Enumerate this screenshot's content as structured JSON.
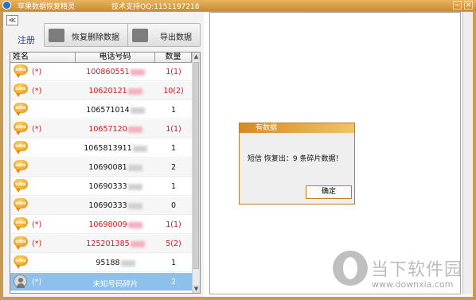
{
  "window": {
    "title": "苹果数据恢复精灵",
    "support": "技术支持QQ:1151197218",
    "min": "−",
    "close": "✕"
  },
  "toolbar": {
    "collapse": "≪",
    "register": "注册",
    "recover_label": "恢复删除数据",
    "export_label": "导出数据"
  },
  "table": {
    "headers": [
      "姓名",
      "电话号码",
      "数量"
    ],
    "rows": [
      {
        "icon": "sms-bubble-icon",
        "flag": "(*)",
        "phone": "100860551",
        "count": "1(1)",
        "deleted": true
      },
      {
        "icon": "sms-bubble-icon",
        "flag": "(*)",
        "phone": "10620121",
        "count": "10(2)",
        "deleted": true
      },
      {
        "icon": "sms-bubble-icon",
        "flag": "",
        "phone": "106571014",
        "count": "1",
        "deleted": false
      },
      {
        "icon": "sms-bubble-icon",
        "flag": "(*)",
        "phone": "10657120",
        "count": "1(1)",
        "deleted": true
      },
      {
        "icon": "sms-bubble-icon",
        "flag": "",
        "phone": "1065813911",
        "count": "1",
        "deleted": false
      },
      {
        "icon": "sms-bubble-icon",
        "flag": "",
        "phone": "10690081",
        "count": "2",
        "deleted": false
      },
      {
        "icon": "sms-bubble-icon",
        "flag": "",
        "phone": "10690333",
        "count": "1",
        "deleted": false
      },
      {
        "icon": "sms-bubble-icon",
        "flag": "",
        "phone": "10690333",
        "count": "0",
        "deleted": false
      },
      {
        "icon": "sms-bubble-icon",
        "flag": "(*)",
        "phone": "10698009",
        "count": "1(1)",
        "deleted": true
      },
      {
        "icon": "sms-bubble-icon",
        "flag": "(*)",
        "phone": "125201385",
        "count": "5(2)",
        "deleted": true
      },
      {
        "icon": "sms-bubble-icon",
        "flag": "",
        "phone": "95188",
        "count": "1",
        "deleted": false
      },
      {
        "icon": "person-icon",
        "flag": "(*)",
        "phone": "未知号码碎片",
        "count": "2",
        "deleted": true,
        "selected": true
      }
    ]
  },
  "dialog": {
    "title": "有数据",
    "message": "短信 恢复出：9 条碎片数据！",
    "ok_label": "确定"
  },
  "watermark": {
    "text": "当下软件园",
    "url": "www.downxia.com"
  },
  "colors": {
    "frame": "#c99a52",
    "deleted_text": "#d01818",
    "selected_row": "#8ec0ec",
    "dialog_accent": "#d48a25"
  }
}
